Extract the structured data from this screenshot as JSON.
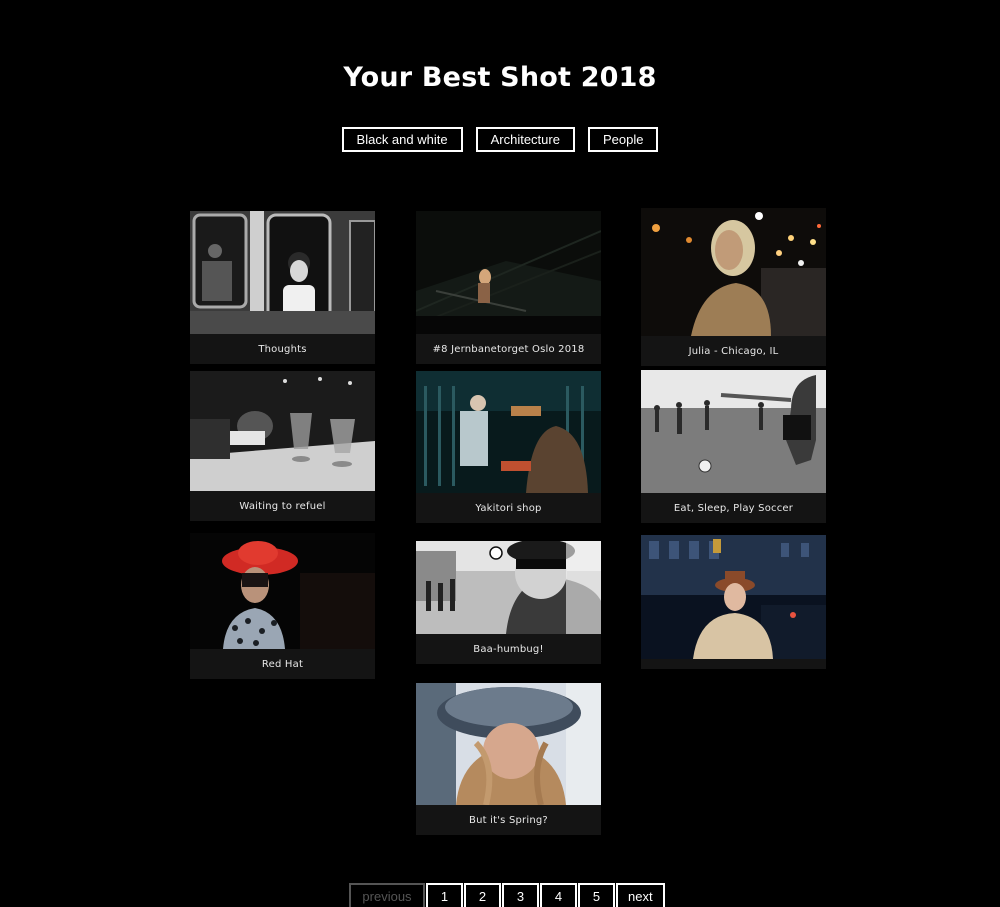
{
  "page": {
    "title": "Your Best Shot 2018"
  },
  "filters": [
    "Black and white",
    "Architecture",
    "People"
  ],
  "photos": [
    {
      "caption": "Thoughts"
    },
    {
      "caption": "#8 Jernbanetorget Oslo 2018"
    },
    {
      "caption": "Julia - Chicago, IL"
    },
    {
      "caption": "Waiting to refuel"
    },
    {
      "caption": "Yakitori shop"
    },
    {
      "caption": "Eat, Sleep, Play Soccer"
    },
    {
      "caption": "Red Hat"
    },
    {
      "caption": "Baa-humbug!"
    },
    {
      "caption": ""
    },
    {
      "caption": "But it's Spring?"
    }
  ],
  "pagination": {
    "previous": "previous",
    "pages": [
      "1",
      "2",
      "3",
      "4",
      "5"
    ],
    "next": "next"
  }
}
